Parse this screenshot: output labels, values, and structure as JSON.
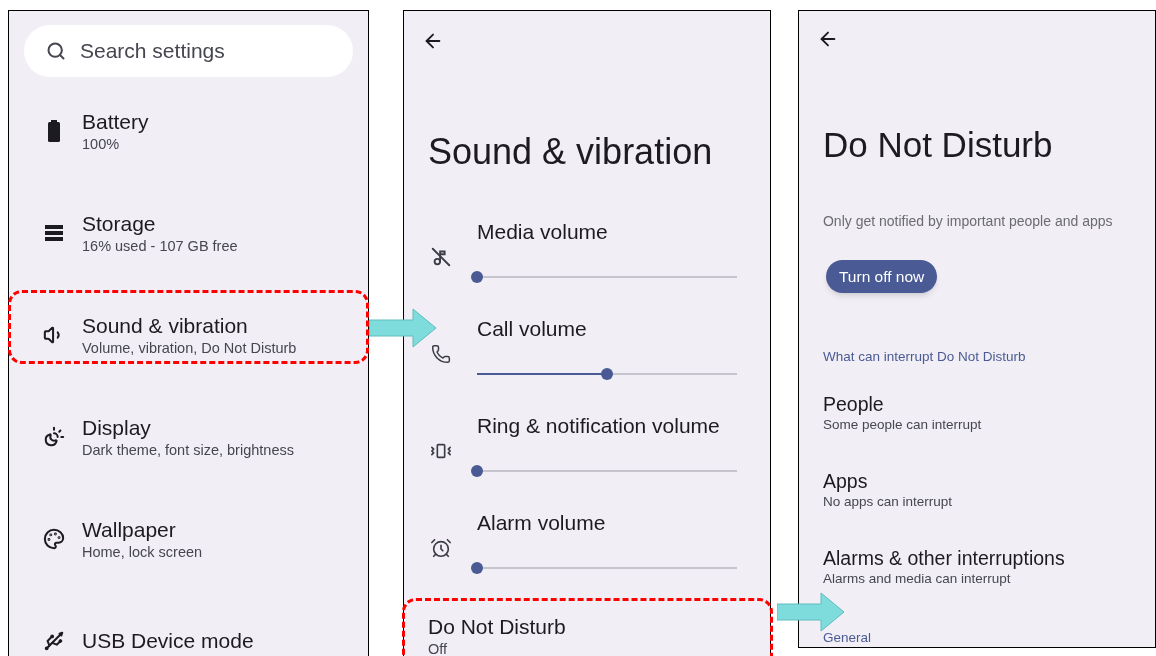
{
  "settings_screen": {
    "search": {
      "placeholder": "Search settings"
    },
    "items": [
      {
        "title": "Battery",
        "subtitle": "100%",
        "highlighted": false
      },
      {
        "title": "Storage",
        "subtitle": "16% used - 107 GB free",
        "highlighted": false
      },
      {
        "title": "Sound & vibration",
        "subtitle": "Volume, vibration, Do Not Disturb",
        "highlighted": true
      },
      {
        "title": "Display",
        "subtitle": "Dark theme, font size, brightness",
        "highlighted": false
      },
      {
        "title": "Wallpaper",
        "subtitle": "Home, lock screen",
        "highlighted": false
      },
      {
        "title": "USB Device mode",
        "highlighted": false
      }
    ]
  },
  "sound_screen": {
    "title": "Sound & vibration",
    "sliders": [
      {
        "label": "Media volume",
        "level": 0
      },
      {
        "label": "Call volume",
        "level": 0.5
      },
      {
        "label": "Ring & notification volume",
        "level": 0
      },
      {
        "label": "Alarm volume",
        "level": 0
      }
    ],
    "items": [
      {
        "title": "Do Not Disturb",
        "subtitle": "Off",
        "highlighted": true
      }
    ]
  },
  "dnd_screen": {
    "title": "Do Not Disturb",
    "description": "Only get notified by important people and apps",
    "button": "Turn off now",
    "sections": [
      {
        "kind": "header",
        "text": "What can interrupt Do Not Disturb"
      },
      {
        "kind": "item",
        "title": "People",
        "subtitle": "Some people can interrupt"
      },
      {
        "kind": "item",
        "title": "Apps",
        "subtitle": "No apps can interrupt"
      },
      {
        "kind": "item",
        "title": "Alarms & other interruptions",
        "subtitle": "Alarms and media can interrupt"
      },
      {
        "kind": "header",
        "text": "General"
      }
    ]
  }
}
